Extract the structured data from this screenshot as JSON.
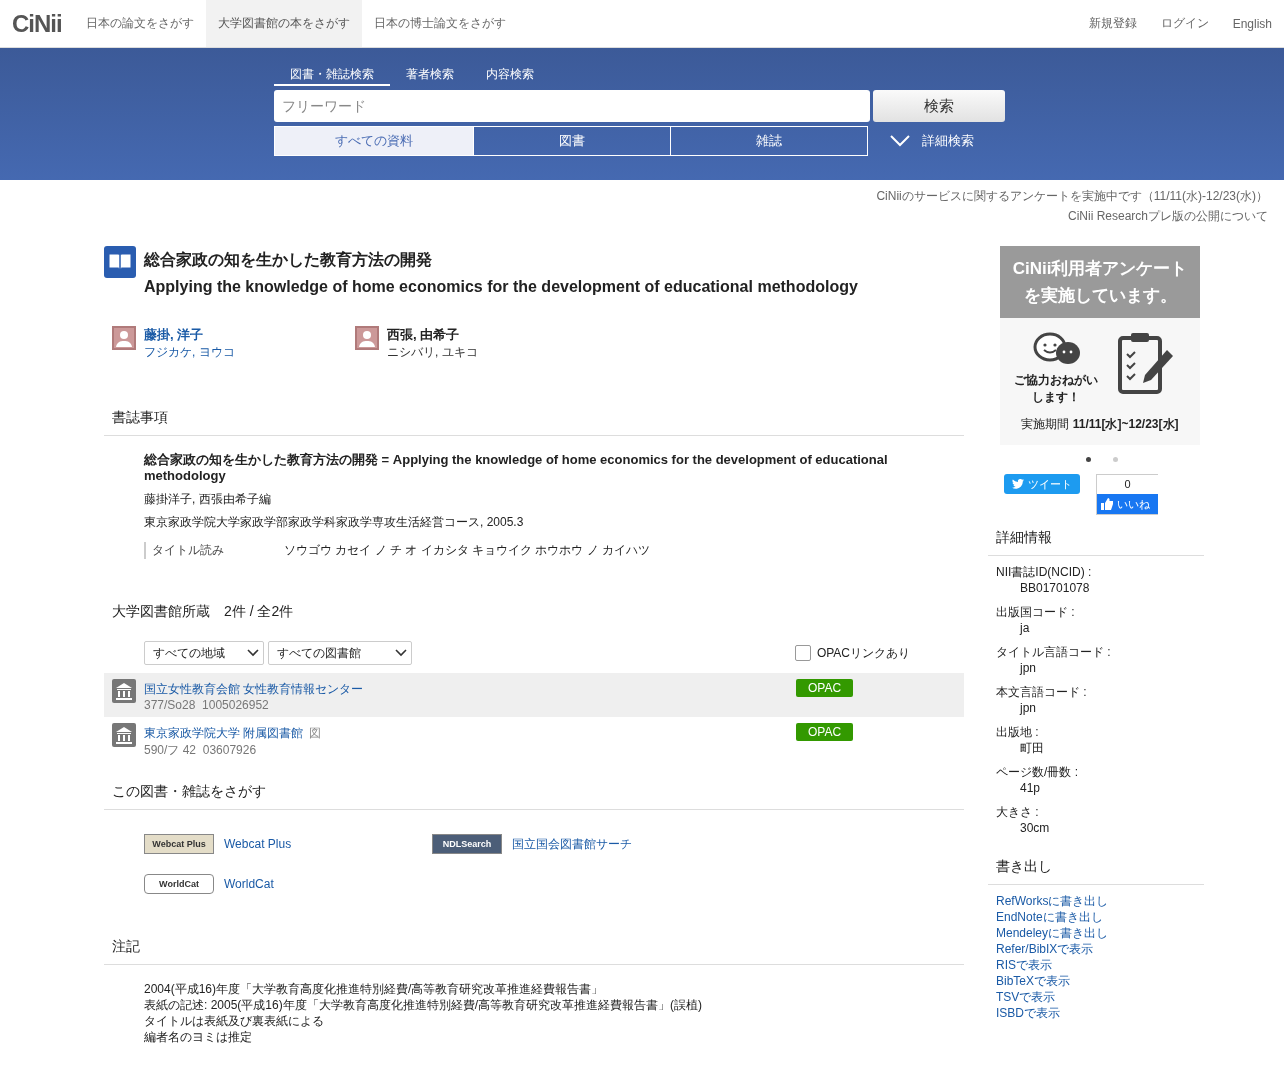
{
  "header": {
    "logo": "CiNii",
    "nav_tabs": [
      {
        "label": "日本の論文をさがす",
        "selected": false
      },
      {
        "label": "大学図書館の本をさがす",
        "selected": true
      },
      {
        "label": "日本の博士論文をさがす",
        "selected": false
      }
    ],
    "user_links": [
      "新規登録",
      "ログイン",
      "English"
    ]
  },
  "search": {
    "tabs": [
      {
        "label": "図書・雑誌検索",
        "selected": true
      },
      {
        "label": "著者検索",
        "selected": false
      },
      {
        "label": "内容検索",
        "selected": false
      }
    ],
    "placeholder": "フリーワード",
    "button": "検索",
    "type_tabs": [
      {
        "label": "すべての資料",
        "selected": true
      },
      {
        "label": "図書",
        "selected": false
      },
      {
        "label": "雑誌",
        "selected": false
      }
    ],
    "advanced": "詳細検索"
  },
  "notices": [
    "CiNiiのサービスに関するアンケートを実施中です（11/11(水)-12/23(水)）",
    "CiNii Researchプレ版の公開について"
  ],
  "article": {
    "title_ja": "総合家政の知を生かした教育方法の開発",
    "title_en": "Applying the knowledge of home economics for the development of educational methodology",
    "authors": [
      {
        "name": "藤掛, 洋子",
        "reading": "フジカケ, ヨウコ",
        "linked": true
      },
      {
        "name": "西張, 由希子",
        "reading": "ニシバリ, ユキコ",
        "linked": false
      }
    ]
  },
  "bibliography": {
    "heading": "書誌事項",
    "title": "総合家政の知を生かした教育方法の開発 = Applying the knowledge of home economics for the development of educational methodology",
    "responsibility": "藤掛洋子, 西張由希子編",
    "publisher": "東京家政学院大学家政学部家政学科家政学専攻生活経営コース, 2005.3",
    "fields": [
      {
        "label": "タイトル読み",
        "value": "ソウゴウ カセイ ノ チ オ イカシタ キョウイク ホウホウ ノ カイハツ"
      }
    ]
  },
  "holdings": {
    "heading": "大学図書館所蔵",
    "count": "2件 / 全2件",
    "filters": [
      "すべての地域",
      "すべての図書館"
    ],
    "opac_filter": {
      "label": "OPACリンクあり",
      "checked": false
    },
    "libraries": [
      {
        "name": "国立女性教育会館 女性教育情報センター",
        "call_number": "377/So28  1005026952",
        "highlighted": true,
        "opac": "OPAC"
      },
      {
        "name": "東京家政学院大学 附属図書館",
        "mark": "図",
        "call_number": "590/フ 42  03607926",
        "highlighted": false,
        "opac": "OPAC"
      }
    ]
  },
  "search_elsewhere": {
    "heading": "この図書・雑誌をさがす",
    "services": [
      {
        "kind": "webcat",
        "logo_text": "Webcat Plus",
        "label": "Webcat Plus"
      },
      {
        "kind": "ndl",
        "logo_text": "NDLSearch",
        "label": "国立国会図書館サーチ"
      },
      {
        "kind": "worldcat",
        "logo_text": "WorldCat",
        "label": "WorldCat"
      }
    ]
  },
  "notes": {
    "heading": "注記",
    "lines": [
      "2004(平成16)年度「大学教育高度化推進特別経費/高等教育研究改革推進経費報告書」",
      "表紙の記述: 2005(平成16)年度「大学教育高度化推進特別経費/高等教育研究改革推進経費報告書」(誤植)",
      "タイトルは表紙及び裏表紙による",
      "編者名のヨミは推定"
    ]
  },
  "sidebar": {
    "banner": {
      "title": "CiNii利用者アンケートを実施しています。",
      "caption": "ご協力おねがいします！",
      "period_label": "実施期間",
      "period": "11/11[水]~12/23[水]"
    },
    "carousel_dots": [
      {
        "selected": true
      },
      {
        "selected": false
      }
    ],
    "tweet": "ツイート",
    "like": {
      "count": "0",
      "label": "いいね"
    },
    "details_heading": "詳細情報",
    "details": [
      {
        "label": "NII書誌ID(NCID) :",
        "value": "BB01701078"
      },
      {
        "label": "出版国コード :",
        "value": "ja"
      },
      {
        "label": "タイトル言語コード :",
        "value": "jpn"
      },
      {
        "label": "本文言語コード :",
        "value": "jpn"
      },
      {
        "label": "出版地 :",
        "value": "町田"
      },
      {
        "label": "ページ数/冊数 :",
        "value": "41p"
      },
      {
        "label": "大きさ :",
        "value": "30cm"
      }
    ],
    "export_heading": "書き出し",
    "exports": [
      "RefWorksに書き出し",
      "EndNoteに書き出し",
      "Mendeleyに書き出し",
      "Refer/BibIXで表示",
      "RISで表示",
      "BibTeXで表示",
      "TSVで表示",
      "ISBDで表示"
    ]
  }
}
